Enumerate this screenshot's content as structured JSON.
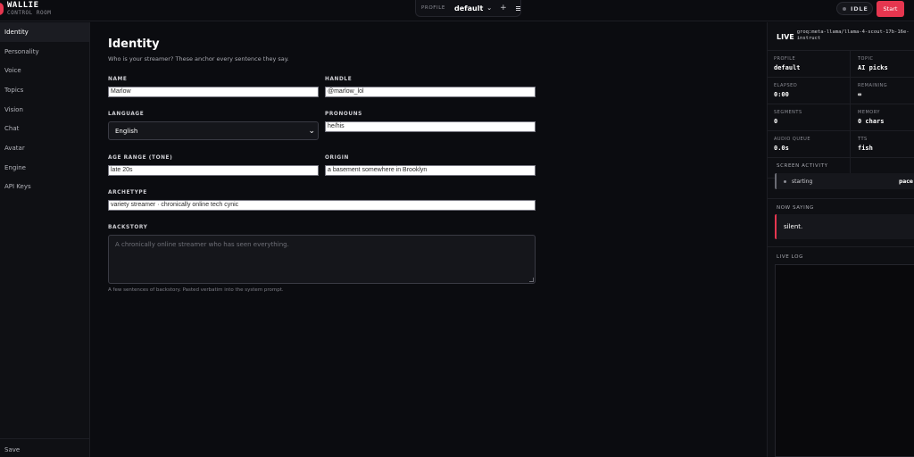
{
  "brand": {
    "title": "WALLIE",
    "subtitle": "CONTROL ROOM"
  },
  "header": {
    "profile_label": "PROFILE",
    "profile_value": "default",
    "add_icon": "+",
    "status": "IDLE",
    "start_label": "Start"
  },
  "sidebar": {
    "items": [
      {
        "label": "Identity",
        "active": true
      },
      {
        "label": "Personality"
      },
      {
        "label": "Voice"
      },
      {
        "label": "Topics"
      },
      {
        "label": "Vision"
      },
      {
        "label": "Chat"
      },
      {
        "label": "Avatar"
      },
      {
        "label": "Engine"
      },
      {
        "label": "API Keys"
      }
    ],
    "save_label": "Save"
  },
  "main": {
    "title": "Identity",
    "subtitle": "Who is your streamer? These anchor every sentence they say.",
    "fields": {
      "name": {
        "label": "NAME",
        "value": "Marlow"
      },
      "handle": {
        "label": "HANDLE",
        "value": "@marlow_lol"
      },
      "language": {
        "label": "LANGUAGE",
        "value": "English"
      },
      "pronouns": {
        "label": "PRONOUNS",
        "value": "he/his"
      },
      "age_range": {
        "label": "AGE RANGE (TONE)",
        "value": "late 20s"
      },
      "origin": {
        "label": "ORIGIN",
        "value": "a basement somewhere in Brooklyn"
      },
      "archetype": {
        "label": "ARCHETYPE",
        "value": "variety streamer · chronically online tech cynic"
      },
      "backstory": {
        "label": "BACKSTORY",
        "placeholder": "A chronically online streamer who has seen everything.",
        "hint": "A few sentences of backstory. Pasted verbatim into the system prompt."
      }
    }
  },
  "panel": {
    "live_label": "LIVE",
    "model": "groq:meta-llama/llama-4-scout-17b-16e-instruct",
    "stats": {
      "profile": {
        "label": "PROFILE",
        "value": "default"
      },
      "topic": {
        "label": "TOPIC",
        "value": "AI picks"
      },
      "elapsed": {
        "label": "ELAPSED",
        "value": "0:00"
      },
      "remaining": {
        "label": "REMAINING",
        "value": "∞"
      },
      "segments": {
        "label": "SEGMENTS",
        "value": "0"
      },
      "memory": {
        "label": "MEMORY",
        "value": "0 chars"
      },
      "audio_queue": {
        "label": "AUDIO QUEUE",
        "value": "0.0s"
      },
      "tts": {
        "label": "TTS",
        "value": "fish"
      }
    },
    "screen_activity": {
      "title": "SCREEN ACTIVITY",
      "state": "starting",
      "right": "pace"
    },
    "now_saying": {
      "title": "NOW SAYING",
      "text": "silent."
    },
    "live_log": {
      "title": "LIVE LOG"
    }
  },
  "colors": {
    "accent": "#e5364f",
    "background": "#0b0c10",
    "panel": "#0e0f13"
  }
}
